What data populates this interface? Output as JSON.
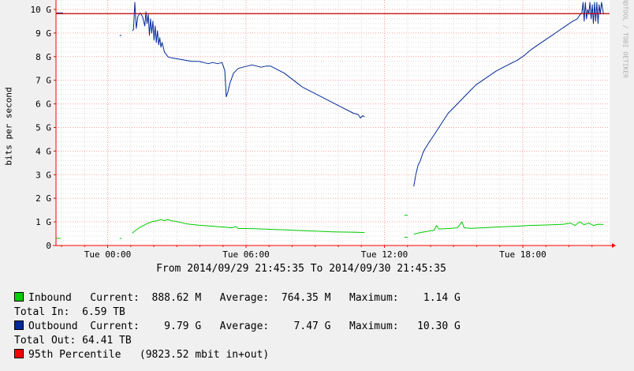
{
  "y_axis_title": "bits per second",
  "watermark": "RRDTOOL / TOBI OETIKER",
  "date_range": "From 2014/09/29 21:45:35 To 2014/09/30 21:45:35",
  "legend": [
    {
      "color": "#00cc00",
      "text": "Inbound   Current:  888.62 M   Average:  764.35 M   Maximum:    1.14 G"
    },
    {
      "color": null,
      "text": "Total In:  6.59 TB"
    },
    {
      "color": "#002a97",
      "text": "Outbound  Current:    9.79 G   Average:    7.47 G   Maximum:   10.30 G"
    },
    {
      "color": null,
      "text": "Total Out: 64.41 TB"
    },
    {
      "color": "#ff0000",
      "text": "95th Percentile   (9823.52 mbit in+out)"
    }
  ],
  "chart_data": {
    "type": "line",
    "x_unit": "hours since 2014/09/29 21:45:35",
    "xlim": [
      0,
      24
    ],
    "x_ticks": [
      {
        "label": "Tue 00:00",
        "x": 2.24
      },
      {
        "label": "Tue 06:00",
        "x": 8.24
      },
      {
        "label": "Tue 12:00",
        "x": 14.24
      },
      {
        "label": "Tue 18:00",
        "x": 20.24
      }
    ],
    "ylim": [
      0,
      10.4
    ],
    "y_unit": "Gbit/s",
    "y_ticks": [
      {
        "label": "0",
        "y": 0
      },
      {
        "label": "1 G",
        "y": 1
      },
      {
        "label": "2 G",
        "y": 2
      },
      {
        "label": "3 G",
        "y": 3
      },
      {
        "label": "4 G",
        "y": 4
      },
      {
        "label": "5 G",
        "y": 5
      },
      {
        "label": "6 G",
        "y": 6
      },
      {
        "label": "7 G",
        "y": 7
      },
      {
        "label": "8 G",
        "y": 8
      },
      {
        "label": "9 G",
        "y": 9
      },
      {
        "label": "10 G",
        "y": 10
      }
    ],
    "percentile_95": 9.8235,
    "series": [
      {
        "name": "Inbound",
        "color": "#00cc00",
        "segments": [
          [
            [
              0.0,
              0.3
            ],
            [
              0.2,
              0.3
            ]
          ],
          [
            [
              2.76,
              0.3
            ],
            [
              2.84,
              0.3
            ]
          ],
          [
            [
              3.31,
              0.52
            ],
            [
              3.4,
              0.6
            ],
            [
              3.6,
              0.75
            ],
            [
              3.8,
              0.85
            ],
            [
              4.0,
              0.95
            ],
            [
              4.2,
              1.02
            ],
            [
              4.4,
              1.05
            ],
            [
              4.55,
              1.1
            ],
            [
              4.7,
              1.05
            ],
            [
              4.85,
              1.1
            ],
            [
              5.0,
              1.05
            ],
            [
              5.2,
              1.02
            ],
            [
              5.4,
              0.98
            ],
            [
              5.6,
              0.93
            ],
            [
              5.8,
              0.9
            ],
            [
              6.0,
              0.88
            ],
            [
              6.2,
              0.86
            ],
            [
              6.5,
              0.84
            ],
            [
              6.8,
              0.82
            ],
            [
              7.0,
              0.8
            ],
            [
              7.3,
              0.78
            ],
            [
              7.6,
              0.75
            ],
            [
              7.8,
              0.8
            ],
            [
              7.9,
              0.72
            ],
            [
              8.2,
              0.72
            ],
            [
              8.6,
              0.71
            ],
            [
              9.0,
              0.7
            ],
            [
              9.5,
              0.68
            ],
            [
              10.0,
              0.66
            ],
            [
              10.5,
              0.64
            ],
            [
              11.0,
              0.62
            ],
            [
              11.5,
              0.6
            ],
            [
              12.0,
              0.58
            ],
            [
              12.5,
              0.57
            ],
            [
              13.0,
              0.56
            ],
            [
              13.38,
              0.55
            ]
          ],
          [
            [
              15.1,
              1.28
            ],
            [
              15.25,
              1.28
            ]
          ],
          [
            [
              15.1,
              0.35
            ],
            [
              15.25,
              0.35
            ]
          ],
          [
            [
              15.51,
              0.48
            ],
            [
              15.8,
              0.55
            ],
            [
              16.1,
              0.6
            ],
            [
              16.4,
              0.65
            ],
            [
              16.5,
              0.85
            ],
            [
              16.6,
              0.7
            ],
            [
              17.0,
              0.72
            ],
            [
              17.4,
              0.75
            ],
            [
              17.6,
              1.0
            ],
            [
              17.7,
              0.75
            ],
            [
              18.0,
              0.73
            ],
            [
              18.5,
              0.75
            ],
            [
              19.0,
              0.78
            ],
            [
              19.5,
              0.8
            ],
            [
              20.0,
              0.82
            ],
            [
              20.5,
              0.85
            ],
            [
              21.0,
              0.86
            ],
            [
              21.5,
              0.88
            ],
            [
              22.0,
              0.9
            ],
            [
              22.3,
              0.95
            ],
            [
              22.5,
              0.85
            ],
            [
              22.7,
              1.0
            ],
            [
              22.9,
              0.88
            ],
            [
              23.1,
              0.95
            ],
            [
              23.3,
              0.85
            ],
            [
              23.5,
              0.9
            ],
            [
              23.74,
              0.89
            ]
          ]
        ]
      },
      {
        "name": "Outbound",
        "color": "#002a97",
        "segments": [
          [
            [
              0.0,
              9.85
            ],
            [
              0.3,
              9.85
            ]
          ],
          [
            [
              2.76,
              8.9
            ],
            [
              2.84,
              8.9
            ]
          ],
          [
            [
              3.31,
              9.1
            ],
            [
              3.36,
              9.15
            ],
            [
              3.42,
              10.3
            ],
            [
              3.48,
              9.2
            ],
            [
              3.55,
              9.7
            ],
            [
              3.65,
              9.85
            ],
            [
              3.75,
              9.7
            ],
            [
              3.85,
              9.3
            ],
            [
              3.9,
              9.9
            ],
            [
              3.95,
              9.4
            ],
            [
              4.0,
              9.8
            ],
            [
              4.05,
              8.9
            ],
            [
              4.1,
              9.6
            ],
            [
              4.15,
              9.0
            ],
            [
              4.2,
              9.5
            ],
            [
              4.25,
              8.7
            ],
            [
              4.3,
              9.3
            ],
            [
              4.35,
              8.6
            ],
            [
              4.4,
              9.1
            ],
            [
              4.45,
              8.5
            ],
            [
              4.5,
              8.8
            ],
            [
              4.55,
              8.4
            ],
            [
              4.6,
              8.6
            ],
            [
              4.7,
              8.2
            ],
            [
              4.85,
              8.0
            ],
            [
              5.0,
              7.95
            ],
            [
              5.3,
              7.9
            ],
            [
              5.6,
              7.85
            ],
            [
              5.9,
              7.8
            ],
            [
              6.2,
              7.8
            ],
            [
              6.4,
              7.75
            ],
            [
              6.6,
              7.7
            ],
            [
              6.8,
              7.75
            ],
            [
              7.0,
              7.7
            ],
            [
              7.2,
              7.75
            ],
            [
              7.32,
              7.4
            ],
            [
              7.38,
              6.3
            ],
            [
              7.45,
              6.5
            ],
            [
              7.55,
              6.9
            ],
            [
              7.7,
              7.3
            ],
            [
              7.9,
              7.5
            ],
            [
              8.1,
              7.55
            ],
            [
              8.3,
              7.6
            ],
            [
              8.5,
              7.65
            ],
            [
              8.7,
              7.6
            ],
            [
              8.9,
              7.55
            ],
            [
              9.1,
              7.6
            ],
            [
              9.3,
              7.6
            ],
            [
              9.5,
              7.5
            ],
            [
              9.7,
              7.4
            ],
            [
              9.9,
              7.3
            ],
            [
              10.1,
              7.15
            ],
            [
              10.3,
              7.0
            ],
            [
              10.5,
              6.85
            ],
            [
              10.7,
              6.7
            ],
            [
              10.9,
              6.6
            ],
            [
              11.1,
              6.5
            ],
            [
              11.3,
              6.4
            ],
            [
              11.5,
              6.3
            ],
            [
              11.7,
              6.2
            ],
            [
              11.9,
              6.1
            ],
            [
              12.1,
              6.0
            ],
            [
              12.3,
              5.9
            ],
            [
              12.5,
              5.8
            ],
            [
              12.7,
              5.7
            ],
            [
              12.9,
              5.6
            ],
            [
              13.1,
              5.55
            ],
            [
              13.2,
              5.4
            ],
            [
              13.3,
              5.5
            ],
            [
              13.38,
              5.45
            ]
          ],
          [
            [
              15.51,
              2.5
            ],
            [
              15.6,
              3.0
            ],
            [
              15.7,
              3.4
            ],
            [
              15.8,
              3.6
            ],
            [
              15.9,
              3.9
            ],
            [
              16.0,
              4.1
            ],
            [
              16.2,
              4.4
            ],
            [
              16.4,
              4.7
            ],
            [
              16.6,
              5.0
            ],
            [
              16.8,
              5.3
            ],
            [
              17.0,
              5.6
            ],
            [
              17.2,
              5.8
            ],
            [
              17.4,
              6.0
            ],
            [
              17.6,
              6.2
            ],
            [
              17.8,
              6.4
            ],
            [
              18.0,
              6.6
            ],
            [
              18.2,
              6.8
            ],
            [
              18.5,
              7.0
            ],
            [
              18.8,
              7.2
            ],
            [
              19.1,
              7.4
            ],
            [
              19.4,
              7.55
            ],
            [
              19.7,
              7.7
            ],
            [
              20.0,
              7.85
            ],
            [
              20.3,
              8.05
            ],
            [
              20.6,
              8.3
            ],
            [
              20.9,
              8.5
            ],
            [
              21.2,
              8.7
            ],
            [
              21.5,
              8.9
            ],
            [
              21.8,
              9.1
            ],
            [
              22.1,
              9.3
            ],
            [
              22.4,
              9.5
            ],
            [
              22.6,
              9.6
            ],
            [
              22.7,
              9.75
            ],
            [
              22.8,
              9.85
            ],
            [
              22.85,
              10.3
            ],
            [
              22.9,
              9.5
            ],
            [
              22.95,
              10.3
            ],
            [
              23.0,
              9.6
            ],
            [
              23.05,
              10.0
            ],
            [
              23.1,
              9.8
            ],
            [
              23.15,
              10.3
            ],
            [
              23.2,
              9.6
            ],
            [
              23.25,
              10.2
            ],
            [
              23.3,
              9.4
            ],
            [
              23.35,
              10.3
            ],
            [
              23.4,
              9.5
            ],
            [
              23.45,
              10.3
            ],
            [
              23.5,
              9.4
            ],
            [
              23.55,
              10.2
            ],
            [
              23.6,
              9.8
            ],
            [
              23.65,
              10.3
            ],
            [
              23.74,
              9.8
            ]
          ]
        ]
      }
    ]
  }
}
